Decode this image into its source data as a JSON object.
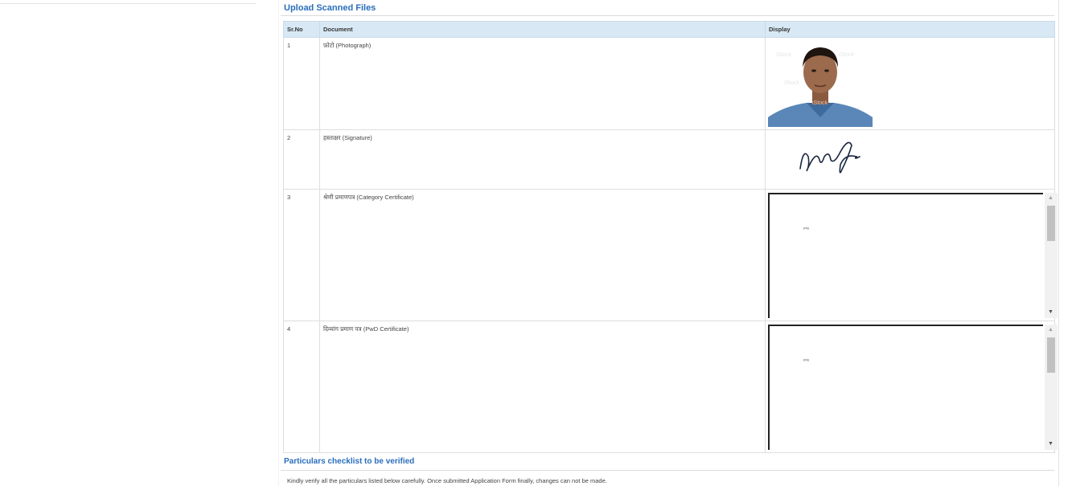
{
  "upload_section": {
    "title": "Upload Scanned Files",
    "columns": {
      "sr": "Sr.No",
      "document": "Document",
      "display": "Display"
    },
    "rows": [
      {
        "sr": "1",
        "document": "फ़ोटो (Photograph)",
        "display_type": "photo"
      },
      {
        "sr": "2",
        "document": "हस्ताक्षर (Signature)",
        "display_type": "signature"
      },
      {
        "sr": "3",
        "document": "श्रेणी प्रमाणपत्र (Category Certificate)",
        "display_type": "embedded-document",
        "embedded_text": "pdg"
      },
      {
        "sr": "4",
        "document": "दिव्यांग प्रमाण पत्र (PwD Certificate)",
        "display_type": "embedded-document",
        "embedded_text": "pdg"
      }
    ]
  },
  "checklist_section": {
    "title": "Particulars checklist to be verified",
    "note": "Kindly verify all the particulars listed below carefully. Once submitted Application Form finally, changes can not be made."
  },
  "colors": {
    "section_title": "#2a6ebb",
    "table_header_bg": "#d8e9f5"
  }
}
